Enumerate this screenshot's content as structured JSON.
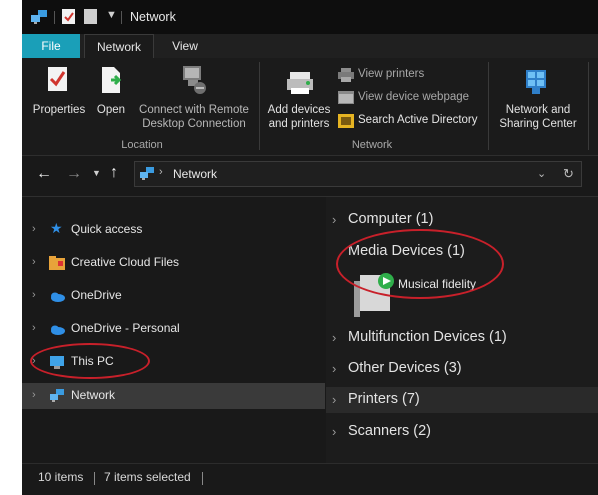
{
  "title_bar": {
    "window_title": "Network"
  },
  "tabs": [
    {
      "label": "File"
    },
    {
      "label": "Network"
    },
    {
      "label": "View"
    }
  ],
  "ribbon": {
    "location_group": {
      "label": "Location",
      "items": [
        {
          "label": "Properties",
          "icon": "properties-icon"
        },
        {
          "label": "Open",
          "icon": "open-icon"
        },
        {
          "label_line1": "Connect with Remote",
          "label_line2": "Desktop Connection",
          "icon": "remote-desktop-icon"
        }
      ]
    },
    "network_group": {
      "label": "Network",
      "add_devices": {
        "label_line1": "Add devices",
        "label_line2": "and printers",
        "icon": "add-devices-icon"
      },
      "small_items": [
        {
          "label": "View printers",
          "icon": "printer-icon"
        },
        {
          "label": "View device webpage",
          "icon": "webpage-icon"
        },
        {
          "label": "Search Active Directory",
          "icon": "directory-icon"
        }
      ]
    },
    "sharing_center": {
      "label_line1": "Network and",
      "label_line2": "Sharing Center",
      "icon": "network-sharing-icon"
    }
  },
  "address_bar": {
    "path": "Network"
  },
  "nav_pane": {
    "items": [
      {
        "label": "Quick access",
        "icon": "star-icon"
      },
      {
        "label": "Creative Cloud Files",
        "icon": "cloud-folder-icon"
      },
      {
        "label": "OneDrive",
        "icon": "onedrive-icon"
      },
      {
        "label": "OneDrive - Personal",
        "icon": "onedrive-icon"
      },
      {
        "label": "This PC",
        "icon": "monitor-icon"
      },
      {
        "label": "Network",
        "icon": "network-icon",
        "selected": true
      }
    ]
  },
  "content": {
    "groups": [
      {
        "label": "Computer (1)",
        "expanded": false
      },
      {
        "label": "Media Devices (1)",
        "expanded": true,
        "items": [
          {
            "label": "Musical fidelity",
            "icon": "media-device-icon"
          }
        ]
      },
      {
        "label": "Multifunction Devices (1)",
        "expanded": false
      },
      {
        "label": "Other Devices (3)",
        "expanded": false
      },
      {
        "label": "Printers (7)",
        "expanded": false
      },
      {
        "label": "Scanners (2)",
        "expanded": false
      }
    ]
  },
  "status_bar": {
    "item_count": "10 items",
    "selected_count": "7 items selected"
  },
  "colors": {
    "window_bg": "#191919",
    "accent": "#1a9fb8",
    "annotation_red": "#c8202a",
    "selection": "#3a3a3a"
  }
}
